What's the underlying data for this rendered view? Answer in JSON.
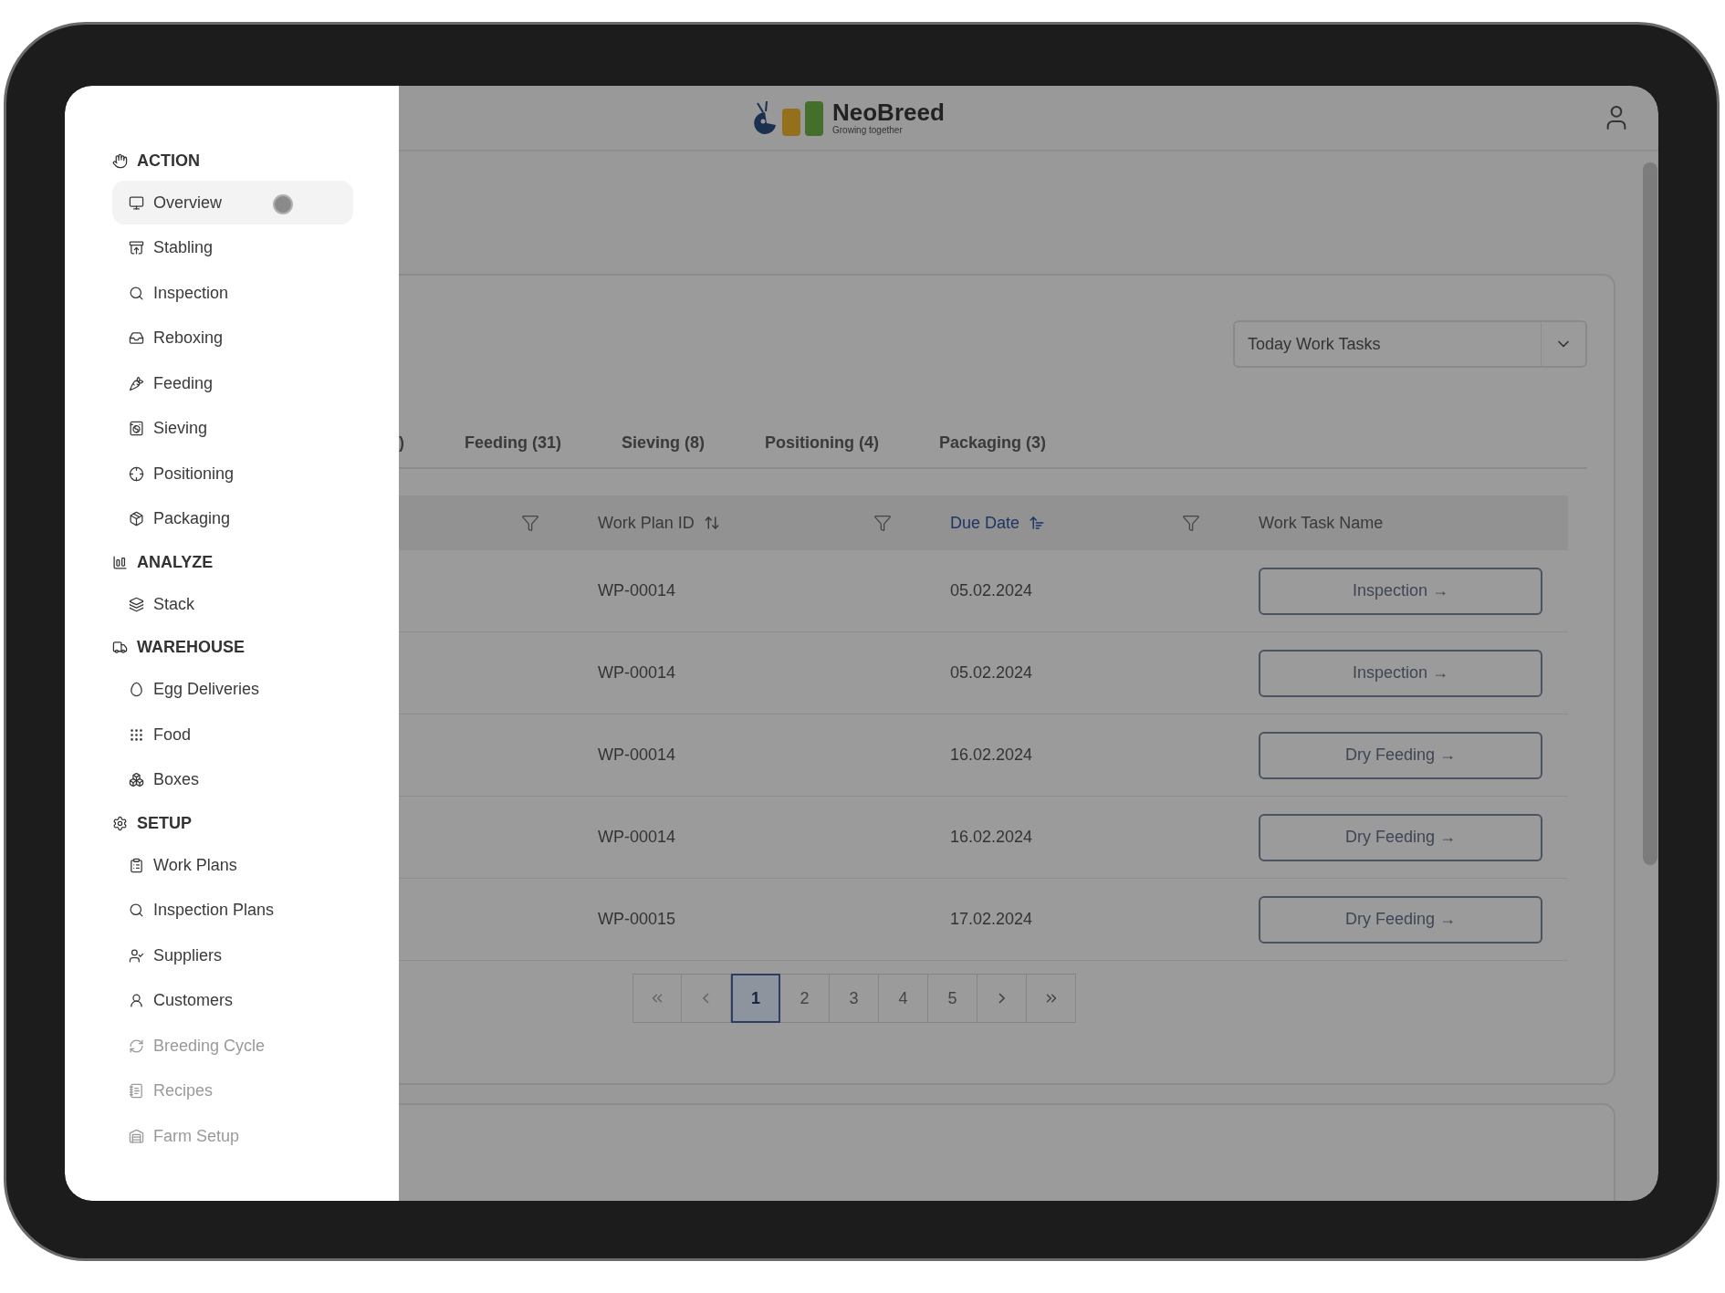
{
  "sidebar": {
    "sections": [
      {
        "title": "ACTION",
        "items": [
          {
            "label": "Overview",
            "selected": true,
            "disabled": false
          },
          {
            "label": "Stabling",
            "selected": false,
            "disabled": false
          },
          {
            "label": "Inspection",
            "selected": false,
            "disabled": false
          },
          {
            "label": "Reboxing",
            "selected": false,
            "disabled": false
          },
          {
            "label": "Feeding",
            "selected": false,
            "disabled": false
          },
          {
            "label": "Sieving",
            "selected": false,
            "disabled": false
          },
          {
            "label": "Positioning",
            "selected": false,
            "disabled": false
          },
          {
            "label": "Packaging",
            "selected": false,
            "disabled": false
          }
        ]
      },
      {
        "title": "ANALYZE",
        "items": [
          {
            "label": "Stack",
            "selected": false,
            "disabled": false
          }
        ]
      },
      {
        "title": "WAREHOUSE",
        "items": [
          {
            "label": "Egg Deliveries",
            "selected": false,
            "disabled": false
          },
          {
            "label": "Food",
            "selected": false,
            "disabled": false
          },
          {
            "label": "Boxes",
            "selected": false,
            "disabled": false
          }
        ]
      },
      {
        "title": "SETUP",
        "items": [
          {
            "label": "Work Plans",
            "selected": false,
            "disabled": false
          },
          {
            "label": "Inspection Plans",
            "selected": false,
            "disabled": false
          },
          {
            "label": "Suppliers",
            "selected": false,
            "disabled": false
          },
          {
            "label": "Customers",
            "selected": false,
            "disabled": false
          },
          {
            "label": "Breeding Cycle",
            "selected": false,
            "disabled": true
          },
          {
            "label": "Recipes",
            "selected": false,
            "disabled": true
          },
          {
            "label": "Farm Setup",
            "selected": false,
            "disabled": true
          }
        ]
      }
    ]
  },
  "header": {
    "brand": "NeoBreed",
    "tagline": "Growing together"
  },
  "task_filter": {
    "value": "Today Work Tasks"
  },
  "tabs": [
    {
      "label": ")",
      "selected": false
    },
    {
      "label": "Feeding (31)",
      "selected": false
    },
    {
      "label": "Sieving (8)",
      "selected": false
    },
    {
      "label": "Positioning (4)",
      "selected": false
    },
    {
      "label": "Packaging (3)",
      "selected": false
    }
  ],
  "table": {
    "columns": [
      {
        "filterable": true
      },
      {
        "label": "Work Plan ID",
        "sortable": true,
        "sorted": false,
        "filterable": true
      },
      {
        "label": "Due Date",
        "sortable": true,
        "sorted": true,
        "filterable": true
      },
      {
        "label": "Work Task Name",
        "sortable": false,
        "filterable": false
      }
    ],
    "rows": [
      {
        "work_plan_id": "WP-00014",
        "due_date": "05.02.2024",
        "task": "Inspection →"
      },
      {
        "work_plan_id": "WP-00014",
        "due_date": "05.02.2024",
        "task": "Inspection →"
      },
      {
        "work_plan_id": "WP-00014",
        "due_date": "16.02.2024",
        "task": "Dry Feeding →"
      },
      {
        "work_plan_id": "WP-00014",
        "due_date": "16.02.2024",
        "task": "Dry Feeding →"
      },
      {
        "work_plan_id": "WP-00015",
        "due_date": "17.02.2024",
        "task": "Dry Feeding →"
      }
    ]
  },
  "pagination": {
    "pages": [
      {
        "label": "1",
        "selected": true
      },
      {
        "label": "2",
        "selected": false
      },
      {
        "label": "3",
        "selected": false
      },
      {
        "label": "4",
        "selected": false
      },
      {
        "label": "5",
        "selected": false
      }
    ]
  }
}
